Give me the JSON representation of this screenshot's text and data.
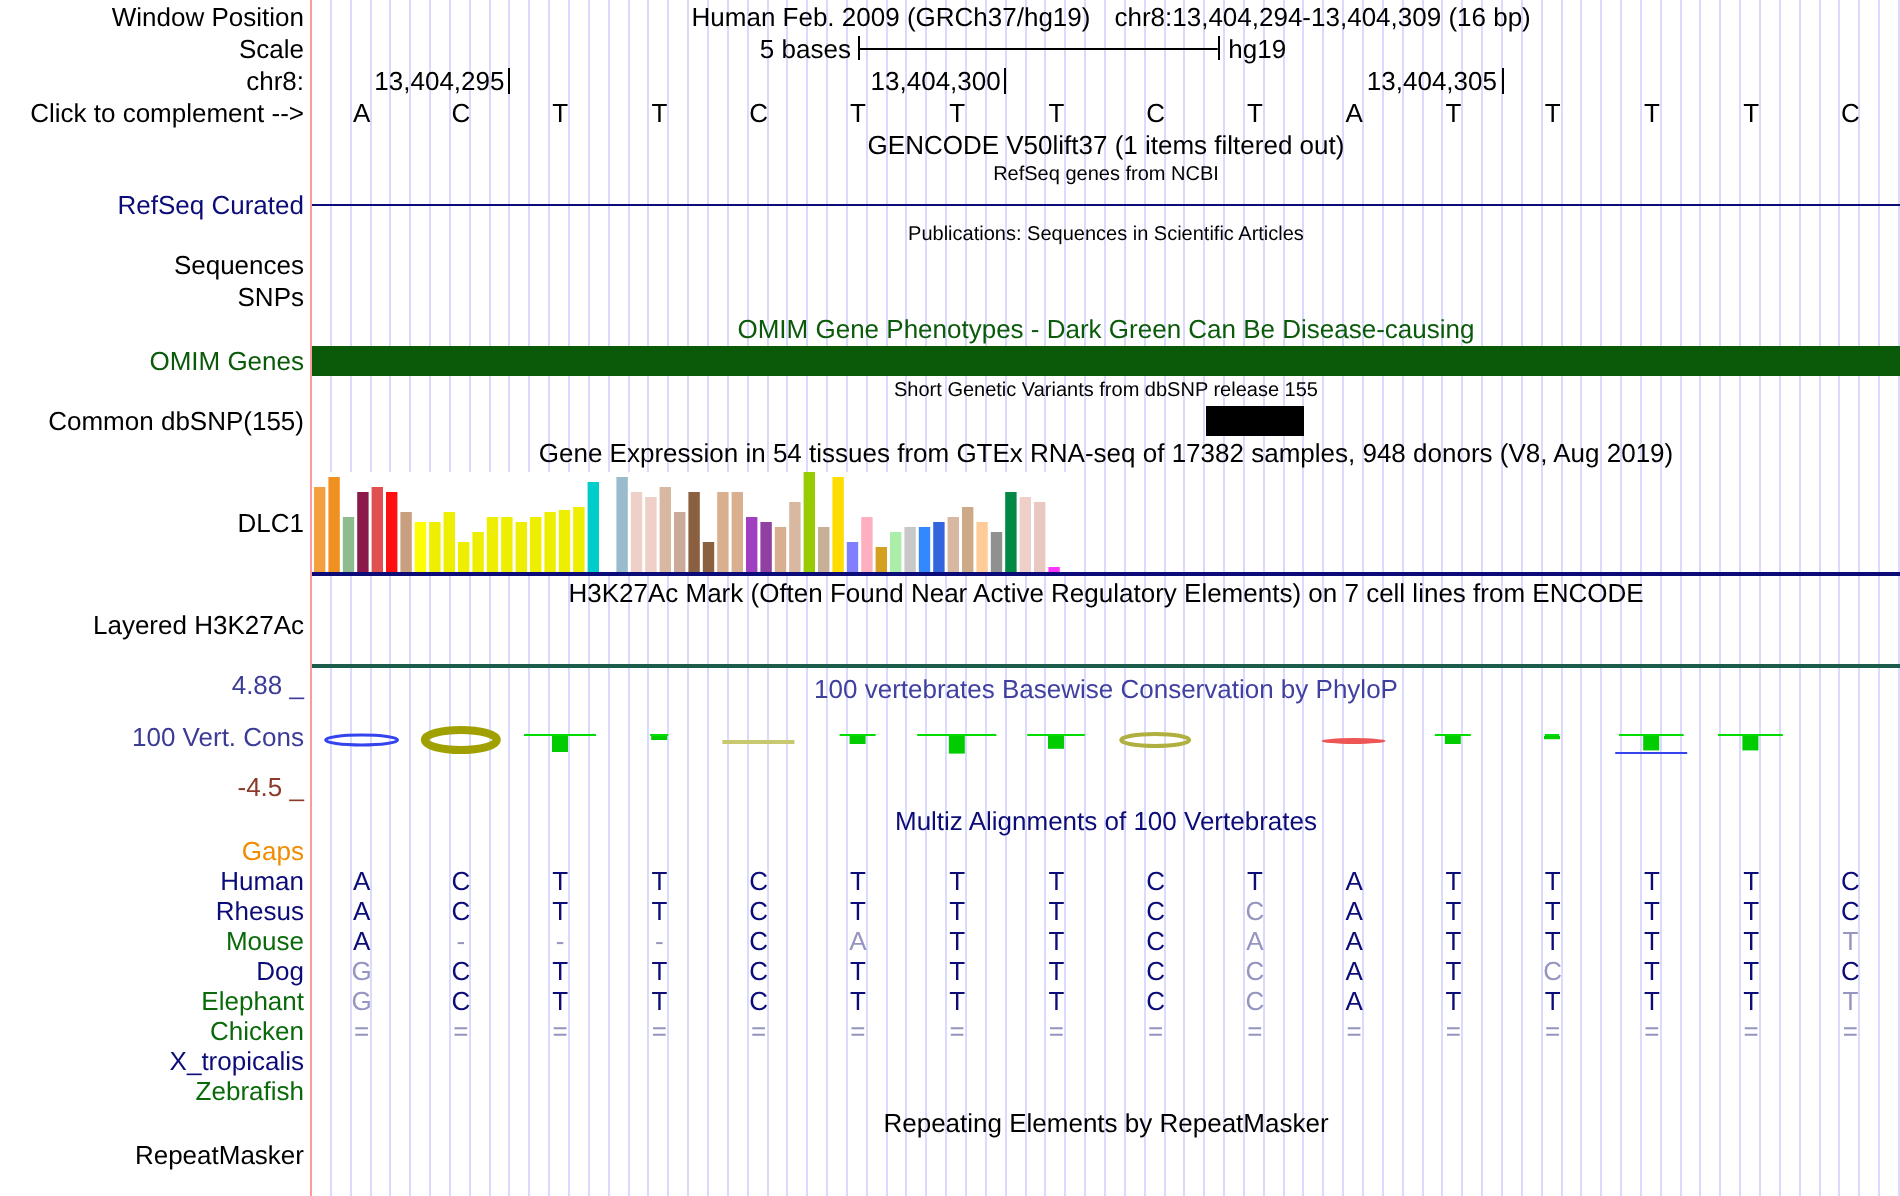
{
  "header": {
    "window_position": {
      "label": "Window Position",
      "assembly": "Human Feb. 2009 (GRCh37/hg19)",
      "position": "chr8:13,404,294-13,404,309 (16 bp)"
    },
    "scale": {
      "label": "Scale",
      "length": "5 bases",
      "assembly": "hg19"
    },
    "coordinates": {
      "label": "chr8:",
      "ticks": [
        "13,404,295",
        "13,404,300",
        "13,404,305"
      ]
    },
    "sequence": {
      "label": "Click to complement -->",
      "bases": [
        "A",
        "C",
        "T",
        "T",
        "C",
        "T",
        "T",
        "T",
        "C",
        "T",
        "A",
        "T",
        "T",
        "T",
        "T",
        "C"
      ]
    }
  },
  "tracks": [
    {
      "kind": "title",
      "title": "GENCODE V50lift37 (1 items filtered out)",
      "small": false
    },
    {
      "kind": "title",
      "title": "RefSeq genes from NCBI",
      "small": true
    },
    {
      "kind": "line",
      "label": "RefSeq Curated",
      "color": "#0c0c78"
    },
    {
      "kind": "title",
      "title": "Publications: Sequences in Scientific Articles",
      "small": true
    },
    {
      "kind": "label",
      "label": "Sequences"
    },
    {
      "kind": "label",
      "label": "SNPs"
    },
    {
      "kind": "title",
      "title": "OMIM Gene Phenotypes - Dark Green Can Be Disease-causing",
      "small": false,
      "color": "#0a5a0a"
    },
    {
      "kind": "bar",
      "label": "OMIM Genes",
      "color": "#0a5a0a"
    },
    {
      "kind": "title",
      "title": "Short Genetic Variants from dbSNP release 155",
      "small": true
    },
    {
      "kind": "variant",
      "label": "Common dbSNP(155)"
    },
    {
      "kind": "title",
      "title": "Gene Expression in 54 tissues from GTEx RNA-seq of 17382 samples, 948 donors (V8, Aug 2019)",
      "small": false
    },
    {
      "kind": "expression",
      "label": "DLC1",
      "color": "#0c0c78"
    },
    {
      "kind": "title",
      "title": "H3K27Ac Mark (Often Found Near Active Regulatory Elements) on 7 cell lines from ENCODE",
      "small": false
    },
    {
      "kind": "label",
      "label": "Layered H3K27Ac"
    },
    {
      "kind": "line",
      "color": "#1d5b4b"
    },
    {
      "kind": "phylop",
      "label": "100 Vert. Cons",
      "color": "#3c3c96",
      "title": "100 vertebrates Basewise Conservation by PhyloP",
      "max": {
        "text": "4.88 _",
        "color": "#3c3c96"
      },
      "min": {
        "text": "-4.5 _",
        "color": "#8b3a2a"
      }
    },
    {
      "kind": "title",
      "title": "Multiz Alignments of 100 Vertebrates",
      "small": false,
      "color": "#0c0c78"
    },
    {
      "kind": "alignment",
      "species": [
        {
          "name": "Gaps",
          "color": "#f08c00"
        },
        {
          "name": "Human",
          "color": "#0c0c78",
          "bases": [
            {
              "base": "A",
              "faded": false
            },
            {
              "base": "C",
              "faded": false
            },
            {
              "base": "T",
              "faded": false
            },
            {
              "base": "T",
              "faded": false
            },
            {
              "base": "C",
              "faded": false
            },
            {
              "base": "T",
              "faded": false
            },
            {
              "base": "T",
              "faded": false
            },
            {
              "base": "T",
              "faded": false
            },
            {
              "base": "C",
              "faded": false
            },
            {
              "base": "T",
              "faded": false
            },
            {
              "base": "A",
              "faded": false
            },
            {
              "base": "T",
              "faded": false
            },
            {
              "base": "T",
              "faded": false
            },
            {
              "base": "T",
              "faded": false
            },
            {
              "base": "T",
              "faded": false
            },
            {
              "base": "C",
              "faded": false
            }
          ]
        },
        {
          "name": "Rhesus",
          "color": "#0c0c78",
          "bases": [
            {
              "base": "A",
              "faded": false
            },
            {
              "base": "C",
              "faded": false
            },
            {
              "base": "T",
              "faded": false
            },
            {
              "base": "T",
              "faded": false
            },
            {
              "base": "C",
              "faded": false
            },
            {
              "base": "T",
              "faded": false
            },
            {
              "base": "T",
              "faded": false
            },
            {
              "base": "T",
              "faded": false
            },
            {
              "base": "C",
              "faded": false
            },
            {
              "base": "C",
              "faded": true
            },
            {
              "base": "A",
              "faded": false
            },
            {
              "base": "T",
              "faded": false
            },
            {
              "base": "T",
              "faded": false
            },
            {
              "base": "T",
              "faded": false
            },
            {
              "base": "T",
              "faded": false
            },
            {
              "base": "C",
              "faded": false
            }
          ]
        },
        {
          "name": "Mouse",
          "color": "#0a6a0a",
          "bases": [
            {
              "base": "A",
              "faded": false
            },
            {
              "base": "-",
              "faded": true
            },
            {
              "base": "-",
              "faded": true
            },
            {
              "base": "-",
              "faded": true
            },
            {
              "base": "C",
              "faded": false
            },
            {
              "base": "A",
              "faded": true
            },
            {
              "base": "T",
              "faded": false
            },
            {
              "base": "T",
              "faded": false
            },
            {
              "base": "C",
              "faded": false
            },
            {
              "base": "A",
              "faded": true
            },
            {
              "base": "A",
              "faded": false
            },
            {
              "base": "T",
              "faded": false
            },
            {
              "base": "T",
              "faded": false
            },
            {
              "base": "T",
              "faded": false
            },
            {
              "base": "T",
              "faded": false
            },
            {
              "base": "T",
              "faded": true
            }
          ]
        },
        {
          "name": "Dog",
          "color": "#0c0c78",
          "bases": [
            {
              "base": "G",
              "faded": true
            },
            {
              "base": "C",
              "faded": false
            },
            {
              "base": "T",
              "faded": false
            },
            {
              "base": "T",
              "faded": false
            },
            {
              "base": "C",
              "faded": false
            },
            {
              "base": "T",
              "faded": false
            },
            {
              "base": "T",
              "faded": false
            },
            {
              "base": "T",
              "faded": false
            },
            {
              "base": "C",
              "faded": false
            },
            {
              "base": "C",
              "faded": true
            },
            {
              "base": "A",
              "faded": false
            },
            {
              "base": "T",
              "faded": false
            },
            {
              "base": "C",
              "faded": true
            },
            {
              "base": "T",
              "faded": false
            },
            {
              "base": "T",
              "faded": false
            },
            {
              "base": "C",
              "faded": false
            }
          ]
        },
        {
          "name": "Elephant",
          "color": "#0a6a0a",
          "bases": [
            {
              "base": "G",
              "faded": true
            },
            {
              "base": "C",
              "faded": false
            },
            {
              "base": "T",
              "faded": false
            },
            {
              "base": "T",
              "faded": false
            },
            {
              "base": "C",
              "faded": false
            },
            {
              "base": "T",
              "faded": false
            },
            {
              "base": "T",
              "faded": false
            },
            {
              "base": "T",
              "faded": false
            },
            {
              "base": "C",
              "faded": false
            },
            {
              "base": "C",
              "faded": true
            },
            {
              "base": "A",
              "faded": false
            },
            {
              "base": "T",
              "faded": false
            },
            {
              "base": "T",
              "faded": false
            },
            {
              "base": "T",
              "faded": false
            },
            {
              "base": "T",
              "faded": false
            },
            {
              "base": "T",
              "faded": true
            }
          ]
        },
        {
          "name": "Chicken",
          "color": "#0a6a0a",
          "bases": [
            {
              "base": "=",
              "faded": true
            },
            {
              "base": "=",
              "faded": true
            },
            {
              "base": "=",
              "faded": true
            },
            {
              "base": "=",
              "faded": true
            },
            {
              "base": "=",
              "faded": true
            },
            {
              "base": "=",
              "faded": true
            },
            {
              "base": "=",
              "faded": true
            },
            {
              "base": "=",
              "faded": true
            },
            {
              "base": "=",
              "faded": true
            },
            {
              "base": "=",
              "faded": true
            },
            {
              "base": "=",
              "faded": true
            },
            {
              "base": "=",
              "faded": true
            },
            {
              "base": "=",
              "faded": true
            },
            {
              "base": "=",
              "faded": true
            },
            {
              "base": "=",
              "faded": true
            },
            {
              "base": "=",
              "faded": true
            }
          ]
        },
        {
          "name": "X_tropicalis",
          "color": "#0c0c78"
        },
        {
          "name": "Zebrafish",
          "color": "#0a6a0a"
        }
      ]
    },
    {
      "kind": "title",
      "title": "Repeating Elements by RepeatMasker",
      "small": false
    },
    {
      "kind": "label",
      "label": "RepeatMasker"
    }
  ]
}
